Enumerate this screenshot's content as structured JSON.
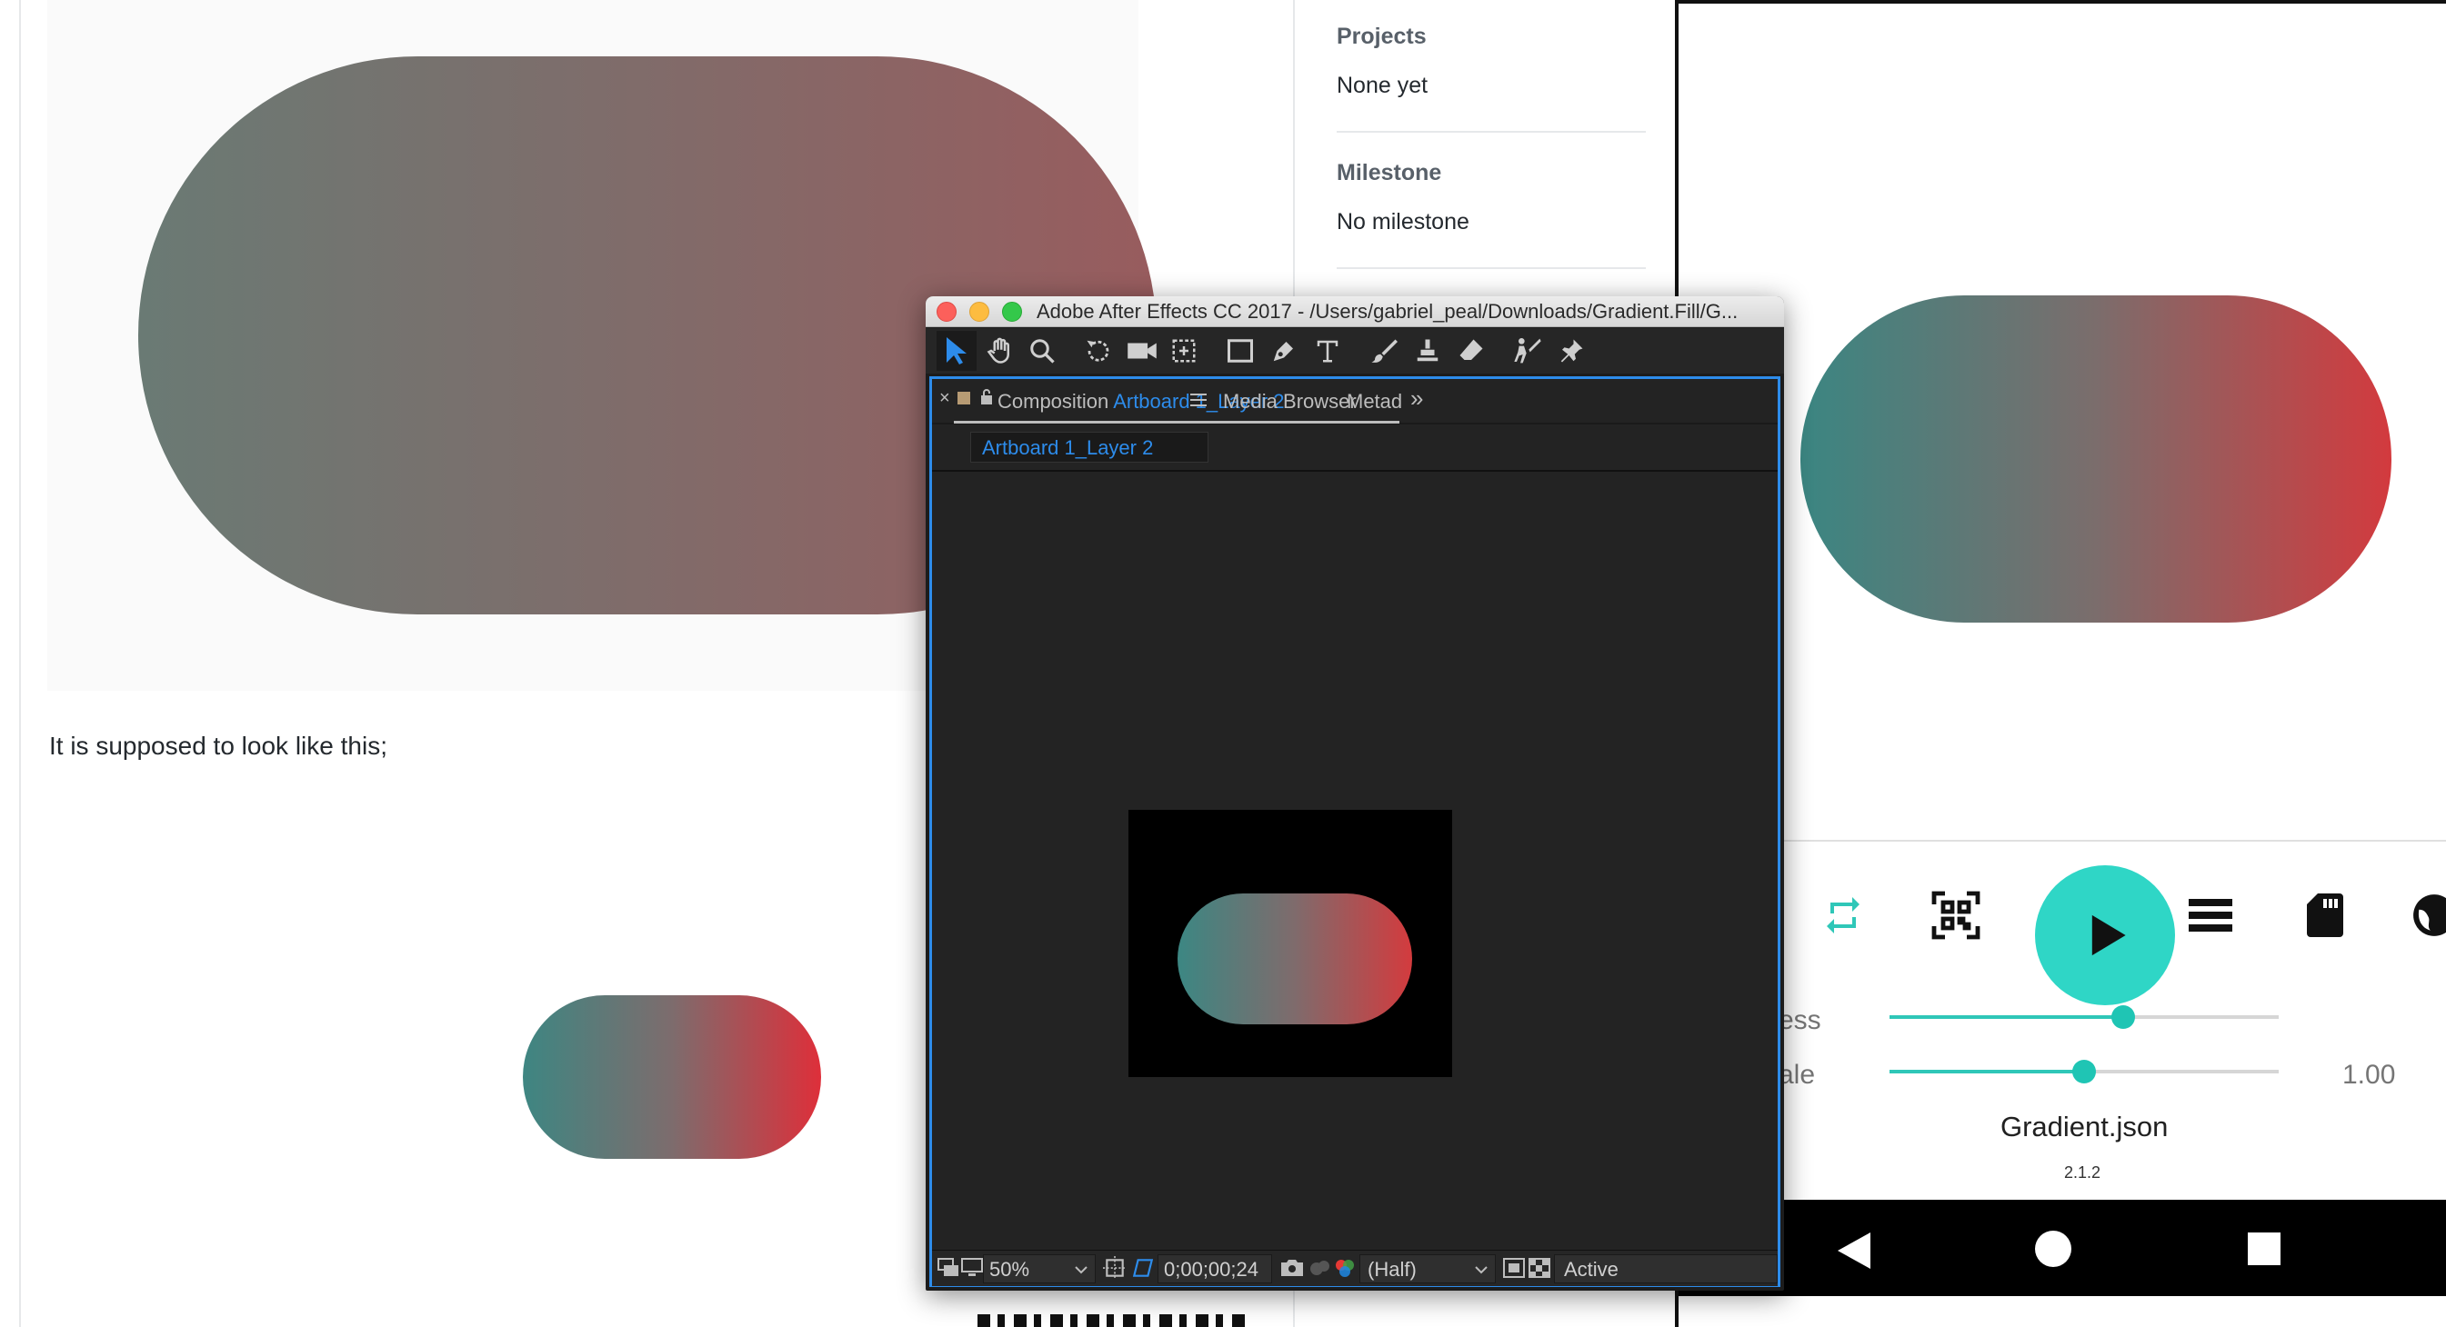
{
  "github": {
    "caption": "It is supposed to look like this;",
    "sidebar": {
      "projects_heading": "Projects",
      "projects_value": "None yet",
      "milestone_heading": "Milestone",
      "milestone_value": "No milestone"
    }
  },
  "after_effects": {
    "window_title": "Adobe After Effects CC 2017 - /Users/gabriel_peal/Downloads/Gradient.Fill/G...",
    "tabs": {
      "composition_prefix": "Composition",
      "composition_name": "Artboard 1_Layer 2",
      "media_browser": "Media Browser",
      "metadata": "Metad",
      "overflow": "»"
    },
    "subtab": "Artboard 1_Layer 2",
    "bottom_bar": {
      "zoom": "50%",
      "timecode": "0;00;00;24",
      "resolution": "(Half)",
      "camera": "Active"
    },
    "tools": [
      "selection-tool",
      "hand-tool",
      "zoom-tool",
      "rotation-tool",
      "camera-tool",
      "pan-behind-tool",
      "rectangle-tool",
      "pen-tool",
      "type-tool",
      "brush-tool",
      "clone-stamp-tool",
      "eraser-tool",
      "roto-brush-tool",
      "puppet-pin-tool"
    ]
  },
  "device": {
    "controls": [
      "repeat-icon",
      "qr-scan-icon",
      "play-icon",
      "list-icon",
      "sd-card-icon",
      "globe-icon"
    ],
    "progress_label": "ess",
    "scale_label": "ale",
    "progress_value": 0.6,
    "scale_fraction": 0.5,
    "scale_value": "1.00",
    "animation_name": "Gradient.json",
    "version": "2.1.2",
    "nav": [
      "back-icon",
      "home-icon",
      "recents-icon"
    ],
    "accent": "#2fd6c6"
  }
}
